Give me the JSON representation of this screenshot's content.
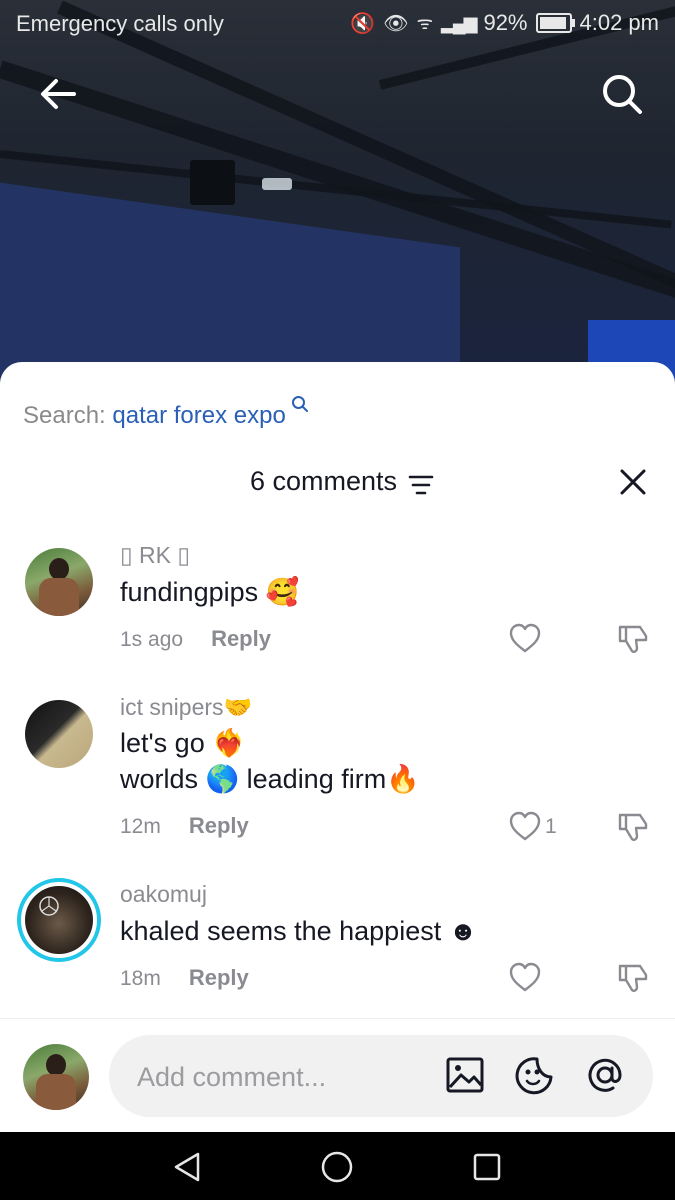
{
  "status_bar": {
    "carrier": "Emergency calls only",
    "battery": "92%",
    "time": "4:02 pm"
  },
  "search": {
    "prefix": "Search:",
    "term": "qatar forex expo"
  },
  "header": {
    "title": "6 comments"
  },
  "comments": [
    {
      "username": "▯ RK ▯",
      "lines": [
        "fundingpips 🥰"
      ],
      "time": "1s ago",
      "reply": "Reply",
      "likes": ""
    },
    {
      "username": "ict snipers🤝",
      "lines": [
        "let's go ❤️‍🔥",
        "worlds 🌎 leading firm🔥"
      ],
      "time": "12m",
      "reply": "Reply",
      "likes": "1"
    },
    {
      "username": "oakomuj",
      "lines": [
        "khaled seems the happiest ☻"
      ],
      "time": "18m",
      "reply": "Reply",
      "likes": ""
    }
  ],
  "composer": {
    "placeholder": "Add comment..."
  },
  "icons": {
    "back": "back-arrow-icon",
    "search": "search-icon",
    "filter": "filter-icon",
    "close": "close-icon",
    "like": "heart-icon",
    "dislike": "thumbs-down-icon",
    "image": "image-icon",
    "emoji": "emoji-icon",
    "mention": "at-icon"
  },
  "colors": {
    "link_blue": "#2a5fb5",
    "story_ring": "#22c6e8",
    "text": "#161823",
    "muted": "#8a8b91"
  }
}
